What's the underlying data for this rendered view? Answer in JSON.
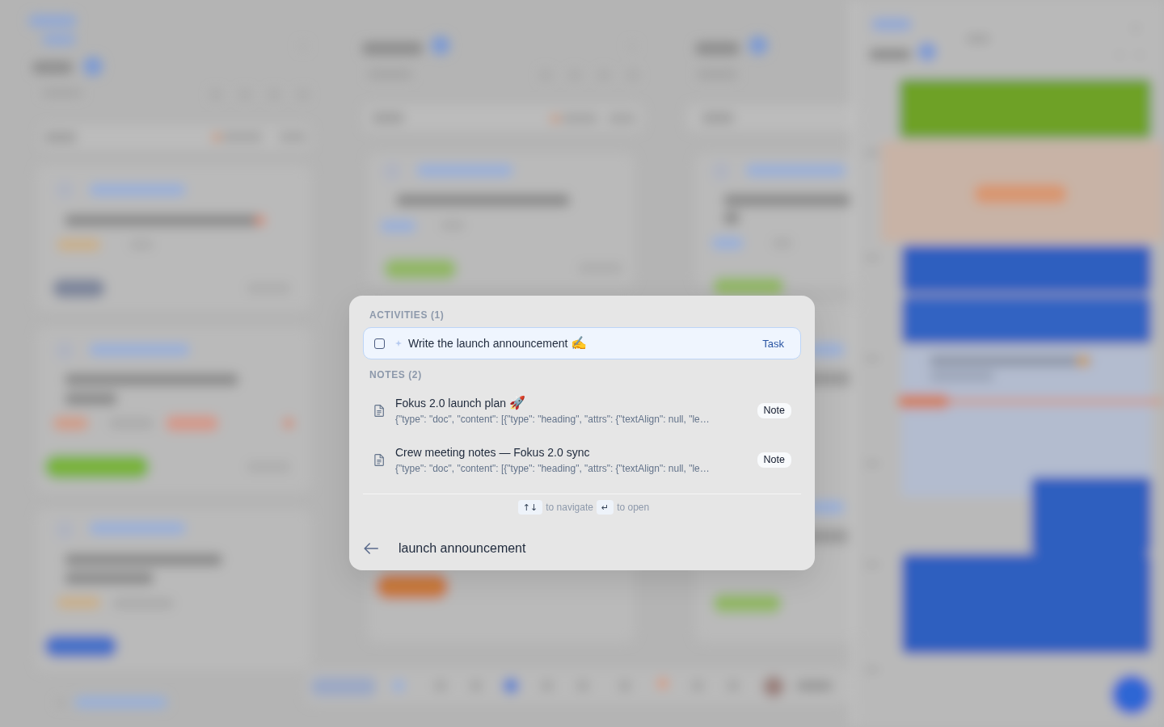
{
  "command_palette": {
    "sections": [
      {
        "heading": "ACTIVITIES (1)",
        "items": [
          {
            "kind": "task",
            "checked": false,
            "selected": true,
            "title": "Write the launch announcement",
            "emoji": "✍️",
            "type_label": "Task"
          }
        ]
      },
      {
        "heading": "NOTES (2)",
        "items": [
          {
            "kind": "note",
            "selected": false,
            "title": "Fokus 2.0 launch plan",
            "emoji": "🚀",
            "snippet": "{\"type\": \"doc\", \"content\": [{\"type\": \"heading\", \"attrs\": {\"textAlign\": null, \"le…",
            "type_label": "Note"
          },
          {
            "kind": "note",
            "selected": false,
            "title": "Crew meeting notes — Fokus 2.0 sync",
            "snippet": "{\"type\": \"doc\", \"content\": [{\"type\": \"heading\", \"attrs\": {\"textAlign\": null, \"le…",
            "type_label": "Note"
          }
        ]
      }
    ],
    "hints": [
      {
        "key": "↑↓",
        "label": "to navigate"
      },
      {
        "key": "↵",
        "label": "to open"
      }
    ],
    "search": {
      "value": "launch announcement"
    }
  }
}
